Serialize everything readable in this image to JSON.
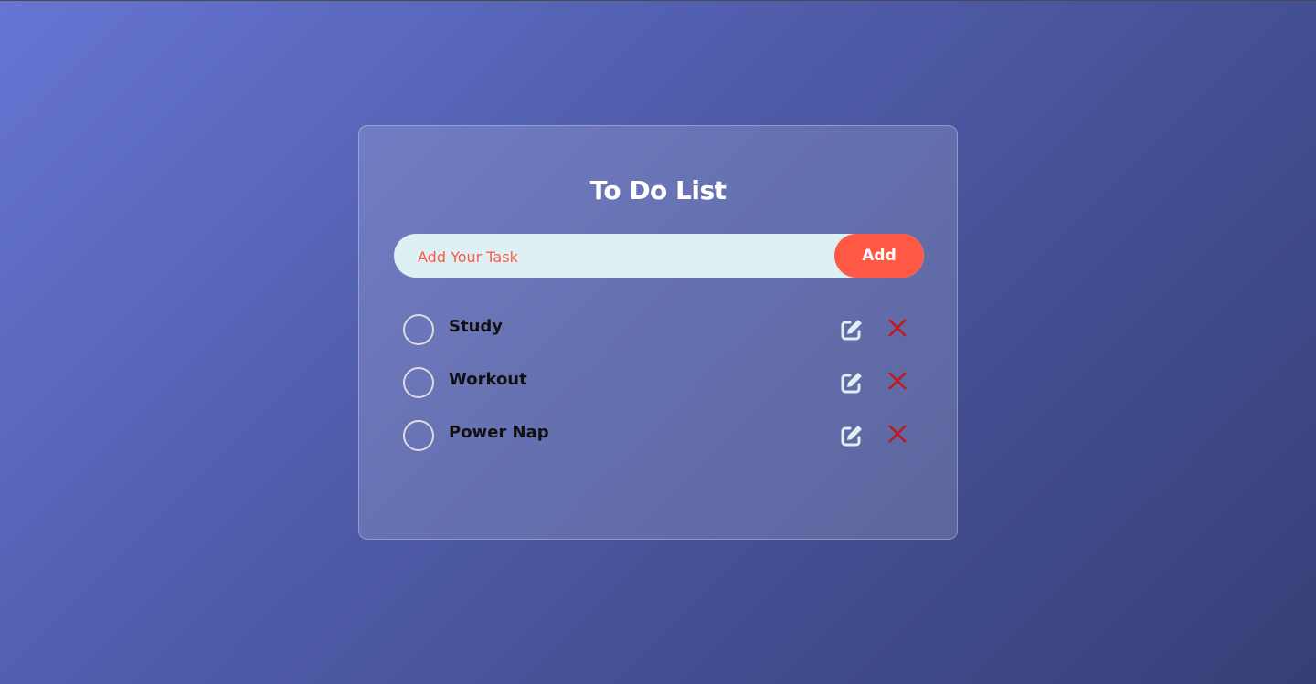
{
  "title": "To Do List",
  "input": {
    "placeholder": "Add Your Task",
    "value": ""
  },
  "add_label": "Add",
  "tasks": [
    {
      "label": "Study",
      "done": false
    },
    {
      "label": "Workout",
      "done": false
    },
    {
      "label": "Power Nap",
      "done": false
    }
  ],
  "colors": {
    "accent": "#ff5945",
    "delete": "#c4161c",
    "input_bg": "#def0f3"
  },
  "icons": {
    "check": "circle-icon",
    "edit": "edit-icon",
    "delete": "close-icon"
  }
}
